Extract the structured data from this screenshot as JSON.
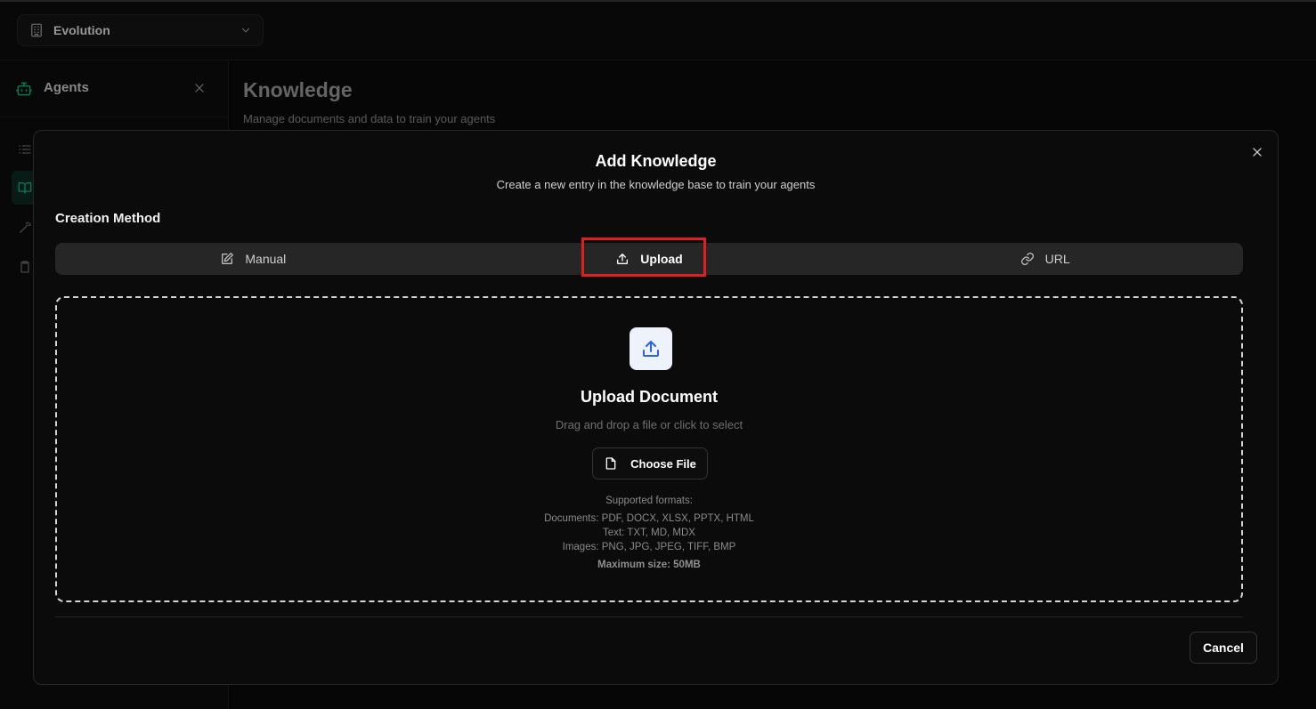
{
  "topbar": {
    "org_selector": {
      "name": "Evolution",
      "icon": "building-icon",
      "chevron": "chevron-down-icon"
    }
  },
  "sidebar": {
    "title": "Agents",
    "icon": "bot-icon",
    "close_icon": "close-icon",
    "items": [
      {
        "icon": "list-icon",
        "active": false
      },
      {
        "icon": "book-open-icon",
        "active": true
      },
      {
        "icon": "wand-icon",
        "active": false
      },
      {
        "icon": "clipboard-icon",
        "active": false
      }
    ]
  },
  "page": {
    "title": "Knowledge",
    "subtitle": "Manage documents and data to train your agents"
  },
  "modal": {
    "title": "Add Knowledge",
    "subtitle": "Create a new entry in the knowledge base to train your agents",
    "method_label": "Creation Method",
    "tabs": [
      {
        "label": "Manual",
        "icon": "edit-icon",
        "active": false
      },
      {
        "label": "Upload",
        "icon": "upload-icon",
        "active": true
      },
      {
        "label": "URL",
        "icon": "link-icon",
        "active": false
      }
    ],
    "dropzone": {
      "title": "Upload Document",
      "subtitle": "Drag and drop a file or click to select",
      "choose_label": "Choose File",
      "formats_heading": "Supported formats:",
      "formats_documents": "Documents: PDF, DOCX, XLSX, PPTX, HTML",
      "formats_text": "Text: TXT, MD, MDX",
      "formats_images": "Images: PNG, JPG, JPEG, TIFF, BMP",
      "max_size": "Maximum size: 50MB"
    },
    "cancel_label": "Cancel"
  },
  "colors": {
    "accent_green": "#10b981",
    "highlight_red": "#e11d1d",
    "upload_icon_blue": "#2563eb"
  }
}
